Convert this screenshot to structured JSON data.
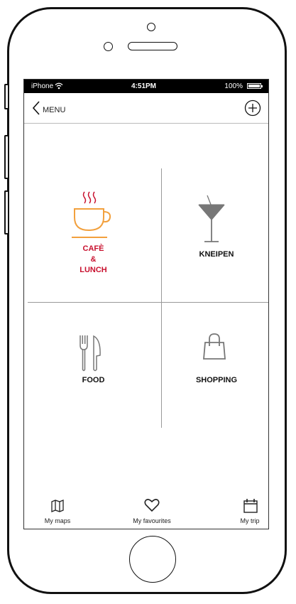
{
  "status": {
    "carrier": "iPhone",
    "time": "4:51PM",
    "battery": "100%",
    "battery_level": 1.0
  },
  "nav": {
    "back_label": "MENU"
  },
  "tiles": [
    {
      "line1": "CAFÈ",
      "line2": "&",
      "line3": "LUNCH",
      "icon": "coffee-cup-icon",
      "color": "#c8102e",
      "icon_color": "#f2a03d"
    },
    {
      "line1": "KNEIPEN",
      "icon": "cocktail-glass-icon",
      "color": "#111111"
    },
    {
      "line1": "FOOD",
      "icon": "fork-knife-icon",
      "color": "#111111"
    },
    {
      "line1": "SHOPPING",
      "icon": "shopping-bag-icon",
      "color": "#111111"
    }
  ],
  "tabbar": [
    {
      "label": "My maps",
      "icon": "map-icon"
    },
    {
      "label": "My favourites",
      "icon": "heart-icon"
    },
    {
      "label": "My trip",
      "icon": "calendar-icon"
    }
  ]
}
